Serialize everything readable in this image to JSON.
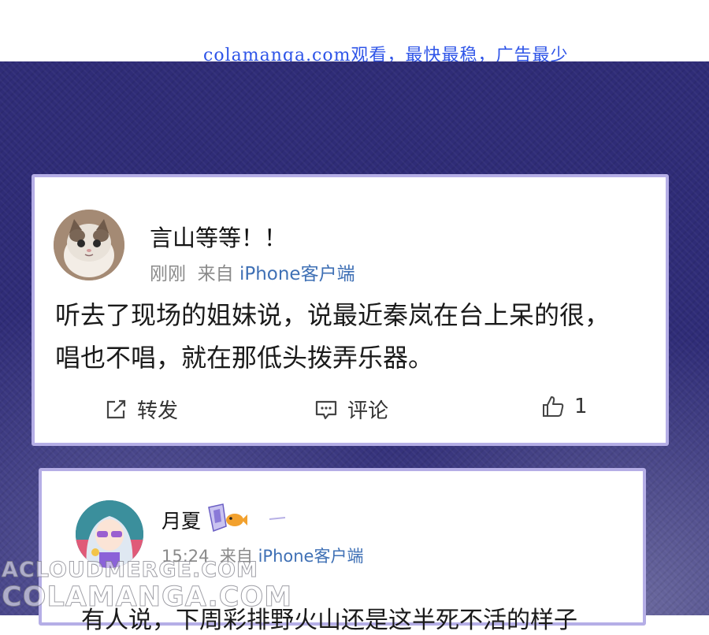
{
  "banner": {
    "text": "colamanga.com观看，最快最稳，广告最少"
  },
  "post1": {
    "username": "言山等等！！",
    "time": "刚刚",
    "from_label": "来自",
    "client": "iPhone客户端",
    "content_line1": "听去了现场的姐妹说，说最近秦岚在台上呆的很，",
    "content_line2": "唱也不唱，就在那低头拨弄乐器。",
    "actions": {
      "repost": "转发",
      "comment": "评论",
      "like_count": "1"
    }
  },
  "post2": {
    "username": "月夏",
    "time": "15:24",
    "from_label": "来自",
    "client": "iPhone客户端",
    "content_partial": "有人说，下周彩排野火山还是这半死不活的样子"
  },
  "watermarks": [
    "ACLOUDMERGE.COM",
    "COLAMANGA.COM"
  ],
  "icons": [
    "repost-icon",
    "comment-icon",
    "like-icon",
    "fish-badge-icon",
    "member-badge-icon"
  ],
  "colors": {
    "background": "#2f2c77",
    "card_border": "#b5aee6",
    "link_blue": "#3f70b5",
    "banner_blue": "#2f55e8"
  }
}
